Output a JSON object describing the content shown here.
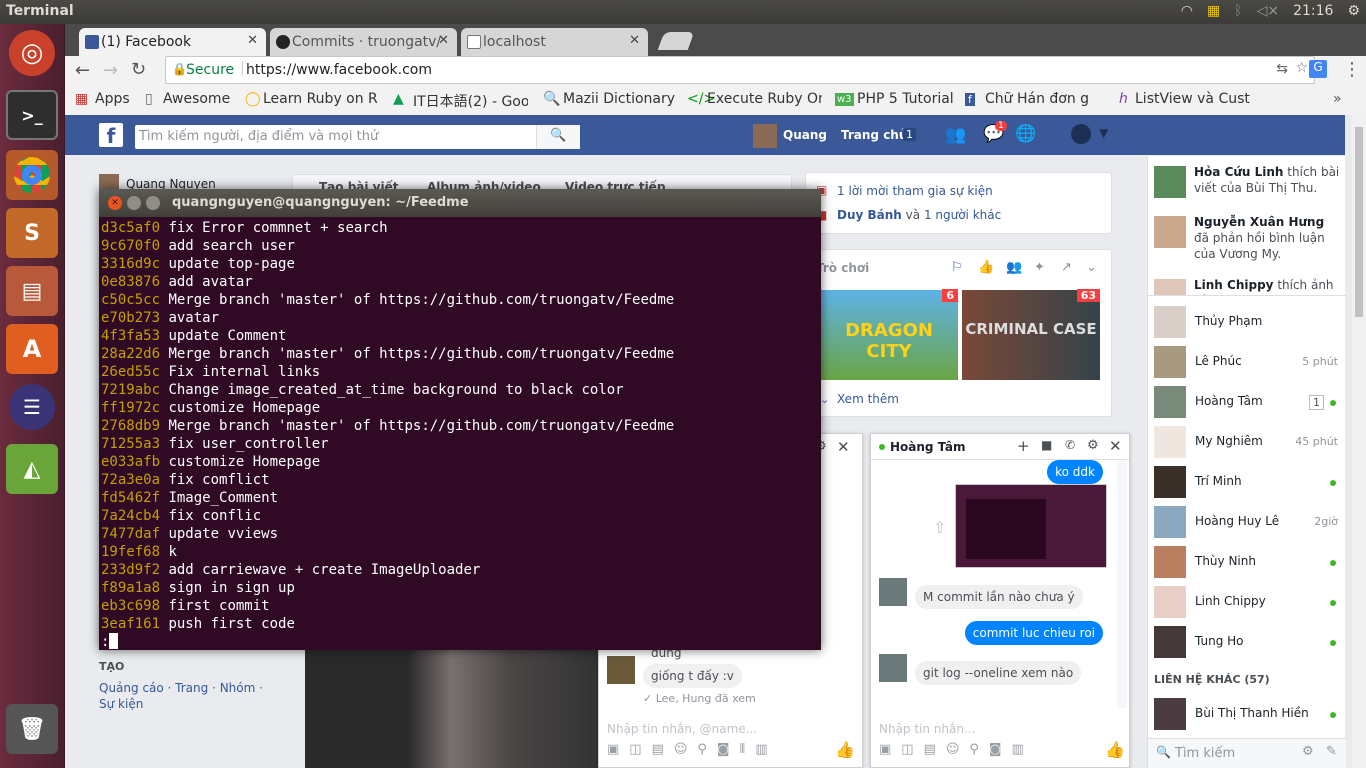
{
  "panel": {
    "app_title": "Terminal",
    "clock": "21:16"
  },
  "launcher": {
    "items": [
      "ubuntu",
      "terminal",
      "chrome",
      "sublime",
      "files",
      "software-center",
      "eclipse",
      "android-studio",
      "trash"
    ]
  },
  "browser": {
    "tabs": [
      {
        "label": "(1) Facebook"
      },
      {
        "label": "Commits · truongatv/"
      },
      {
        "label": "localhost"
      }
    ],
    "secure_label": "Secure",
    "url": "https://www.facebook.com",
    "bookmarks": [
      "Apps",
      "Awesome",
      "Learn Ruby on Ra",
      "IT日本語(2) - Goo",
      "Mazii Dictionary",
      "Execute Ruby On",
      "PHP 5 Tutorial",
      "Chữ Hán đơn g",
      "ListView và Cust"
    ]
  },
  "fb": {
    "search_placeholder": "Tìm kiếm người, địa điểm và mọi thứ",
    "user_name": "Quang",
    "home_label": "Trang chủ",
    "home_count": "1",
    "messages_badge": "1",
    "left_profile": "Quang Nguyen",
    "composer_tabs": [
      "Tạo bài viết",
      "Album ảnh/video",
      "Video trực tiếp"
    ],
    "create_heading": "TẠO",
    "create_links": "Quảng cáo · Trang · Nhóm · Sự kiện",
    "events": {
      "invite": "1 lời mời tham gia sự kiện",
      "birthday_name": "Duy Bánh",
      "birthday_rest": " và ",
      "birthday_others": "1 người khác"
    },
    "games": {
      "title": "Trò chơi",
      "game1_badge": "6",
      "game2_badge": "63",
      "game1": "DRAGON CITY",
      "game2": "CRIMINAL CASE",
      "see_more": "Xem thêm"
    },
    "ticker": [
      {
        "name": "Hỏa Cứu Linh",
        "text": " thích bài viết của Bùi Thị Thu."
      },
      {
        "name": "Nguyễn Xuân Hưng",
        "text": " đã phản hồi bình luận của Vương My."
      },
      {
        "name": "Linh Chippy",
        "text": " thích ảnh của"
      }
    ],
    "contacts": [
      {
        "name": "Thủy Phạm",
        "status": "",
        "online": false
      },
      {
        "name": "Lê Phúc",
        "status": "5 phút",
        "online": false
      },
      {
        "name": "Hoàng Tâm",
        "status": "1",
        "online": true
      },
      {
        "name": "My Nghiêm",
        "status": "45 phút",
        "online": false
      },
      {
        "name": "Trí Minh",
        "status": "",
        "online": true
      },
      {
        "name": "Hoàng Huy Lê",
        "status": "2giờ",
        "online": false
      },
      {
        "name": "Thùy Ninh",
        "status": "",
        "online": true
      },
      {
        "name": "Linh Chippy",
        "status": "",
        "online": true
      },
      {
        "name": "Tung Ho",
        "status": "",
        "online": true
      }
    ],
    "other_contacts_heading": "LIÊN HỆ KHÁC (57)",
    "other_contacts": [
      {
        "name": "Bùi Thị Thanh Hiền"
      }
    ],
    "chat_search_placeholder": "Tìm kiếm"
  },
  "chat1": {
    "msg_partial": "dung",
    "msg": "giống t đấy :v",
    "seen": "Lee, Hung đã xem",
    "input_placeholder": "Nhập tin nhắn, @name..."
  },
  "chat2": {
    "title": "Hoàng Tâm",
    "messages": [
      {
        "from": "me",
        "text": "ko ddk"
      },
      {
        "from": "them",
        "text": "M commit lần nào chưa ý"
      },
      {
        "from": "me",
        "text": "commit luc chieu roi"
      },
      {
        "from": "them",
        "text": "git log --oneline xem nào"
      }
    ],
    "input_placeholder": "Nhập tin nhắn..."
  },
  "terminal": {
    "title": "quangnguyen@quangnguyen: ~/Feedme",
    "lines": [
      {
        "hash": "d3c5af0",
        "msg": "fix Error commnet + search"
      },
      {
        "hash": "9c670f0",
        "msg": "add search user"
      },
      {
        "hash": "3316d9c",
        "msg": "update top-page"
      },
      {
        "hash": "0e83876",
        "msg": "add avatar"
      },
      {
        "hash": "c50c5cc",
        "msg": "Merge branch 'master' of https://github.com/truongatv/Feedme"
      },
      {
        "hash": "e70b273",
        "msg": "avatar"
      },
      {
        "hash": "4f3fa53",
        "msg": "update Comment"
      },
      {
        "hash": "28a22d6",
        "msg": "Merge branch 'master' of https://github.com/truongatv/Feedme"
      },
      {
        "hash": "26ed55c",
        "msg": "Fix internal links"
      },
      {
        "hash": "7219abc",
        "msg": "Change image_created_at_time background to black color"
      },
      {
        "hash": "ff1972c",
        "msg": "customize Homepage"
      },
      {
        "hash": "2768db9",
        "msg": "Merge branch 'master' of https://github.com/truongatv/Feedme"
      },
      {
        "hash": "71255a3",
        "msg": "fix user_controller"
      },
      {
        "hash": "e033afb",
        "msg": "customize Homepage"
      },
      {
        "hash": "72a3e0a",
        "msg": "fix comflict"
      },
      {
        "hash": "fd5462f",
        "msg": "Image_Comment"
      },
      {
        "hash": "7a24cb4",
        "msg": "fix conflic"
      },
      {
        "hash": "7477daf",
        "msg": "update vviews"
      },
      {
        "hash": "19fef68",
        "msg": "k"
      },
      {
        "hash": "233d9f2",
        "msg": "add carriewave + create ImageUploader"
      },
      {
        "hash": "f89a1a8",
        "msg": "sign in sign up"
      },
      {
        "hash": "eb3c698",
        "msg": "first commit"
      },
      {
        "hash": "3eaf161",
        "msg": "push first code"
      }
    ],
    "prompt": ":"
  }
}
